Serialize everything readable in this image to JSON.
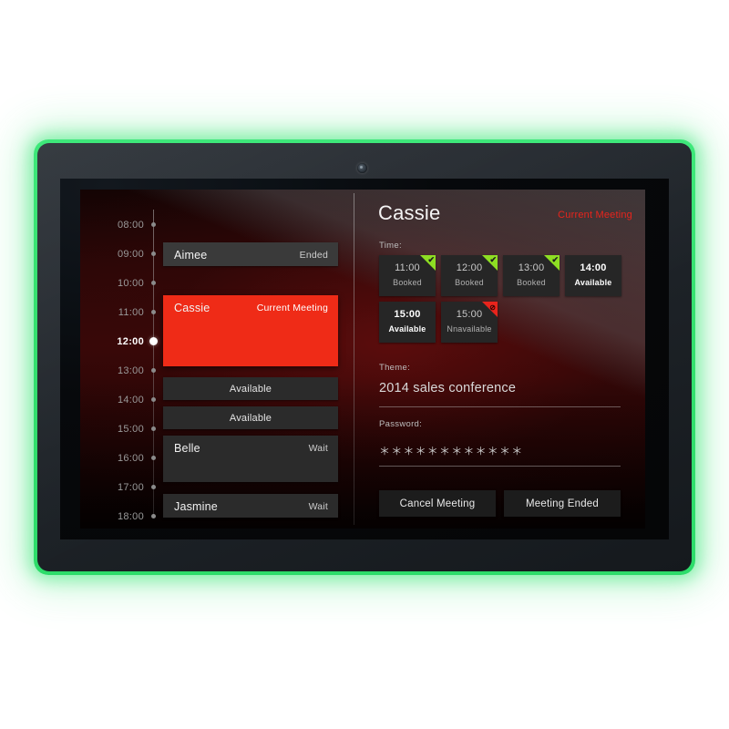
{
  "device": {
    "glow_color": "#35e06f",
    "bezel_color": "#242a30",
    "camera": "front-camera"
  },
  "app": {
    "accent_red": "#ef2b17",
    "accent_green": "#8ede23",
    "background": "#380808"
  },
  "schedule": {
    "time_labels": [
      "08:00",
      "09:00",
      "10:00",
      "11:00",
      "12:00",
      "13:00",
      "14:00",
      "15:00",
      "16:00",
      "17:00",
      "18:00"
    ],
    "current_time": "12:00",
    "events": [
      {
        "name": "Aimee",
        "status": "Ended",
        "type": "ended"
      },
      {
        "name": "Cassie",
        "status": "Current Meeting",
        "type": "current"
      },
      {
        "name": "",
        "status": "Available",
        "type": "available",
        "center_label": "Available"
      },
      {
        "name": "",
        "status": "Available",
        "type": "available",
        "center_label": "Available"
      },
      {
        "name": "Belle",
        "status": "Wait",
        "type": "wait"
      },
      {
        "name": "Jasmine",
        "status": "Wait",
        "type": "wait"
      }
    ]
  },
  "detail": {
    "title": "Cassie",
    "badge": "Current Meeting",
    "time_label": "Time:",
    "slots": [
      {
        "time": "11:00",
        "state": "Booked",
        "corner": "check",
        "corner_glyph": "✔"
      },
      {
        "time": "12:00",
        "state": "Booked",
        "corner": "check",
        "corner_glyph": "✔"
      },
      {
        "time": "13:00",
        "state": "Booked",
        "corner": "check",
        "corner_glyph": "✔"
      },
      {
        "time": "14:00",
        "state": "Available",
        "corner": "none",
        "corner_glyph": ""
      },
      {
        "time": "15:00",
        "state": "Available",
        "corner": "none",
        "corner_glyph": ""
      },
      {
        "time": "15:00",
        "state": "Nnavailable",
        "corner": "blocked",
        "corner_glyph": "⊘"
      }
    ],
    "theme_label": "Theme:",
    "theme_value": "2014 sales conference",
    "password_label": "Password:",
    "password_value": "＊＊＊＊＊＊＊＊＊＊＊＊",
    "cancel_button": "Cancel Meeting",
    "ended_button": "Meeting Ended"
  }
}
